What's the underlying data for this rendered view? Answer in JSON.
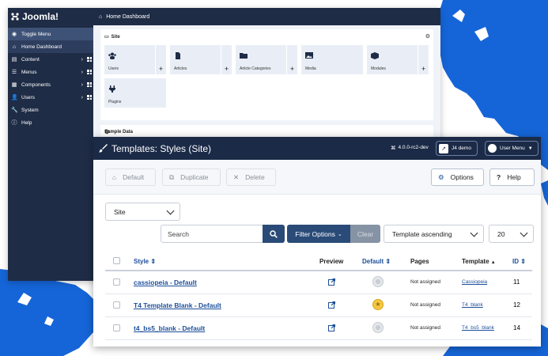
{
  "colors": {
    "brand_blue": "#1565d8",
    "sidebar_bg": "#1f2c46",
    "header_bg": "#1b2a47",
    "link": "#1c4f9a",
    "primary_btn": "#2a4b78"
  },
  "sidebar": {
    "logo": "Joomla!",
    "toggle": "Toggle Menu",
    "items": [
      {
        "label": "Home Dashboard",
        "icon": "home-icon"
      },
      {
        "label": "Content",
        "icon": "file-icon"
      },
      {
        "label": "Menus",
        "icon": "list-icon"
      },
      {
        "label": "Components",
        "icon": "cubes-icon"
      },
      {
        "label": "Users",
        "icon": "users-icon"
      },
      {
        "label": "System",
        "icon": "wrench-icon"
      },
      {
        "label": "Help",
        "icon": "info-icon"
      }
    ]
  },
  "dashboard": {
    "title": "Home Dashboard",
    "site_card": {
      "title": "Site",
      "tiles": [
        "Users",
        "Articles",
        "Article Categories",
        "Media",
        "Modules",
        "Plugins"
      ]
    },
    "sample_data_title": "Sample Data"
  },
  "templates": {
    "title": "Templates: Styles (Site)",
    "version": "4.0.0-rc2-dev",
    "demo_link": "J4 demo",
    "user_menu": "User Menu",
    "toolbar": {
      "default": "Default",
      "duplicate": "Duplicate",
      "delete": "Delete",
      "options": "Options",
      "help": "Help"
    },
    "client_select": "Site",
    "search_placeholder": "Search",
    "filter_options": "Filter Options",
    "clear": "Clear",
    "sort_select": "Template ascending",
    "limit_select": "20",
    "columns": {
      "style": "Style",
      "preview": "Preview",
      "default": "Default",
      "pages": "Pages",
      "template": "Template",
      "id": "ID"
    },
    "rows": [
      {
        "style": "cassiopeia - Default",
        "default": false,
        "pages": "Not assigned",
        "template": "Cassiopeia",
        "id": "11"
      },
      {
        "style": "T4 Template Blank - Default",
        "default": true,
        "pages": "Not assigned",
        "template": "T4_blank",
        "id": "12"
      },
      {
        "style": "t4_bs5_blank - Default",
        "default": false,
        "pages": "Not assigned",
        "template": "T4_bs5_blank",
        "id": "14"
      }
    ]
  }
}
